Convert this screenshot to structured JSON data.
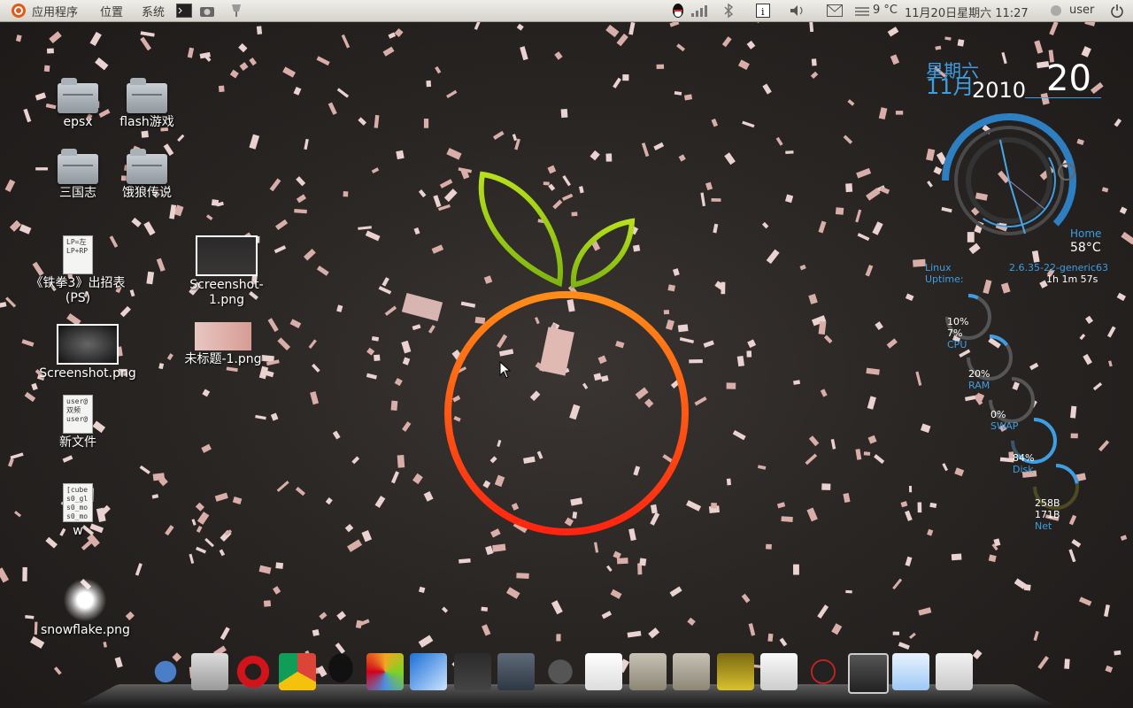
{
  "top_panel": {
    "menus": [
      "应用程序",
      "位置",
      "系统"
    ],
    "weather": "9 °C",
    "datetime": "11月20日星期六 11:27",
    "user": "user"
  },
  "desktop_icons": [
    {
      "label": "epsx",
      "kind": "folder"
    },
    {
      "label": "flash游戏",
      "kind": "folder"
    },
    {
      "label": "三国志",
      "kind": "folder"
    },
    {
      "label": "饿狼传说",
      "kind": "folder"
    },
    {
      "label": "《铁拳3》出招表(PS)",
      "kind": "text-file",
      "preview": "LP=左 LP+RP"
    },
    {
      "label": "Screenshot-1.png",
      "kind": "image"
    },
    {
      "label": "Screenshot.png",
      "kind": "image"
    },
    {
      "label": "未标题-1.png",
      "kind": "image"
    },
    {
      "label": "新文件",
      "kind": "text-file",
      "preview": "user@ 双频 user@"
    },
    {
      "label": "w",
      "kind": "text-file",
      "preview": "[cube s0_gl s0_mo s0_mo"
    },
    {
      "label": "snowflake.png",
      "kind": "image"
    }
  ],
  "calendar_widget": {
    "weekday": "星期六",
    "month": "11月",
    "year": "2010",
    "day": "20"
  },
  "sysinfo_widget": {
    "home_label": "Home",
    "temperature": "58°C",
    "os_label": "Linux",
    "kernel": "2.6.35-22-generic63",
    "uptime_label": "Uptime:",
    "uptime": "1h 1m 57s",
    "meters": [
      {
        "value": "10%",
        "sub": "7%",
        "label": "CPU",
        "fraction": 0.1
      },
      {
        "value": "20%",
        "label": "RAM",
        "fraction": 0.2
      },
      {
        "value": "0%",
        "label": "SWAP",
        "fraction": 0.0
      },
      {
        "value": "84%",
        "label": "Disk",
        "fraction": 0.84
      },
      {
        "value": "258B",
        "sub": "171B",
        "label": "Net",
        "fraction": 0.3
      }
    ]
  },
  "dock_items": [
    "footprints-icon",
    "calculator-icon",
    "opera-icon",
    "chrome-icon",
    "qq-icon",
    "paint-icon",
    "feather-icon",
    "terminal-icon",
    "window-icon",
    "gimp-icon",
    "menu-icon",
    "documents-folder-icon",
    "downloads-folder-icon",
    "photo-icon",
    "text-editor-icon",
    "clock-icon",
    "trash-icon",
    "qq-window-icon",
    "browser-window-icon"
  ],
  "colors": {
    "orange_ring_top": "#ff8a18",
    "orange_ring_bottom": "#ff2a10",
    "leaf": "#9acd14",
    "widget_blue": "#3d9ee3",
    "background": "#2a2624"
  }
}
